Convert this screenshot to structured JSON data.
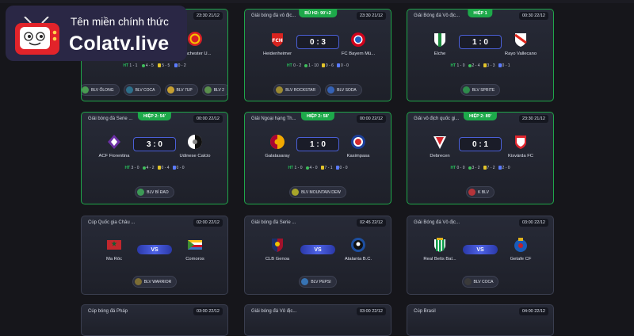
{
  "brand": {
    "tagline": "Tên miền chính thức",
    "name": "Colatv.live"
  },
  "cards": [
    {
      "league": "",
      "status": "",
      "time": "23:30 21/12",
      "home": "",
      "away": "Manchester U...",
      "score": "",
      "stats": "",
      "blv": [
        "BLV ỐLONG",
        "BLV COCA",
        "BLV 7UP",
        "BLV 2"
      ]
    },
    {
      "league": "Giải bóng đá vô địc...",
      "status": "BÙ H2: 90'+2",
      "time": "23:30 21/12",
      "home": "Heidenheimer",
      "away": "FC Bayern Mü...",
      "score": "0 : 3",
      "stats": [
        "0 - 2",
        "1 - 10",
        "0 - 6",
        "0 - 0"
      ],
      "blv": [
        "BLV ROCKSTAR",
        "BLV SODA"
      ]
    },
    {
      "league": "Giải Bóng đá Vô địc...",
      "status": "HIỆP 1",
      "time": "00:30 22/12",
      "home": "Elche",
      "away": "Rayo Vallecano",
      "score": "1 : 0",
      "stats": [
        "1 - 0",
        "2 - 4",
        "3 - 3",
        "0 - 1"
      ],
      "blv": [
        "BLV SPRITE"
      ]
    },
    {
      "league": "Giải bóng đá Serie ...",
      "status": "HIỆP 2: 54'",
      "time": "00:00 22/12",
      "home": "ACF Fiorentina",
      "away": "Udinese Calcio",
      "score": "3 : 0",
      "stats": [
        "3 - 0",
        "4 - 2",
        "0 - 4",
        "0 - 0"
      ],
      "blv": [
        "BLV BÍ ĐAO"
      ]
    },
    {
      "league": "Giải Ngoại hạng Th...",
      "status": "HIỆP 2: 58'",
      "time": "00:00 22/12",
      "home": "Galatasaray",
      "away": "Kasimpasa",
      "score": "1 : 0",
      "stats": [
        "1 - 0",
        "4 - 0",
        "7 - 1",
        "0 - 0"
      ],
      "blv": [
        "BLV MOUNTAIN DEW"
      ]
    },
    {
      "league": "Giải vô địch quốc gi...",
      "status": "HIỆP 2: 89'",
      "time": "23:30 21/12",
      "home": "Debrecen",
      "away": "Kisvárda FC",
      "score": "0 : 1",
      "stats": [
        "0 - 0",
        "3 - 2",
        "7 - 2",
        "2 - 0"
      ],
      "blv": [
        "K BLV"
      ]
    },
    {
      "league": "Cúp Quốc gia Châu ...",
      "status": "",
      "time": "02:00 22/12",
      "home": "Ma Rốc",
      "away": "Comoros",
      "score": "VS",
      "stats": "",
      "blv": [
        "BLV WARRIOR"
      ]
    },
    {
      "league": "Giải bóng đá Serie ...",
      "status": "",
      "time": "02:45 22/12",
      "home": "CLB Genoa",
      "away": "Atalanta B.C.",
      "score": "VS",
      "stats": "",
      "blv": [
        "BLV PEPSI"
      ]
    },
    {
      "league": "Giải Bóng đá Vô địc...",
      "status": "",
      "time": "03:00 22/12",
      "home": "Real Betis Bal...",
      "away": "Getafe CF",
      "score": "VS",
      "stats": "",
      "blv": [
        "BLV COCA"
      ]
    },
    {
      "league": "Cúp bóng đá Pháp",
      "status": "",
      "time": "03:00 22/12",
      "home": "",
      "away": "",
      "score": "",
      "stats": "",
      "blv": []
    },
    {
      "league": "Giải bóng đá Vô địc...",
      "status": "",
      "time": "03:00 22/12",
      "home": "",
      "away": "",
      "score": "",
      "stats": "",
      "blv": []
    },
    {
      "league": "Cúp Brasil",
      "status": "",
      "time": "04:00 22/12",
      "home": "",
      "away": "",
      "score": "",
      "stats": "",
      "blv": []
    }
  ],
  "labels": {
    "ht": "HT"
  },
  "colors": {
    "live_border": "#1fa64a",
    "score_border": "#4a5fd6",
    "background": "#16161b"
  }
}
